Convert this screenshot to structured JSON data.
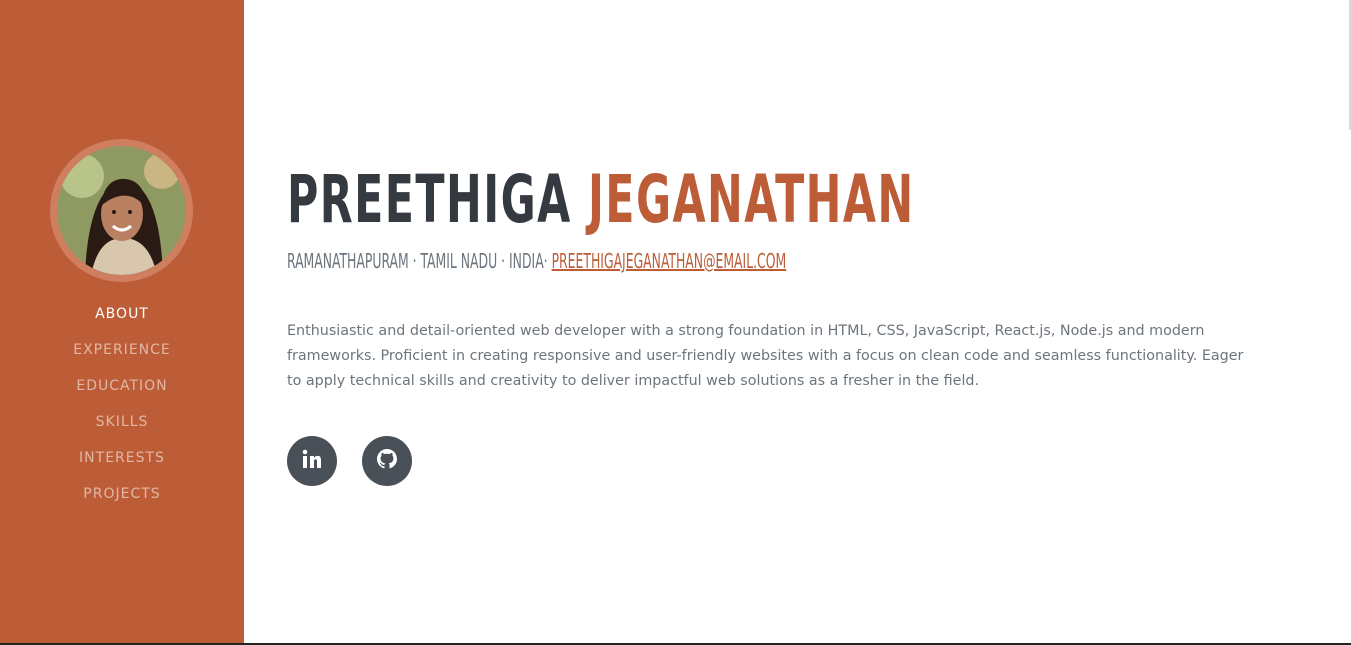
{
  "profile": {
    "avatar_alt": "profile photo",
    "first_name": "PREETHIGA",
    "last_name": "JEGANATHAN",
    "location": "RAMANATHAPURAM · TAMIL NADU · INDIA·",
    "email": "PREETHIGAJEGANATHAN@EMAIL.COM",
    "bio": "Enthusiastic and detail-oriented web developer with a strong foundation in HTML, CSS, JavaScript, React.js, Node.js and modern frameworks. Proficient in creating responsive and user-friendly websites with a focus on clean code and seamless functionality. Eager to apply technical skills and creativity to deliver impactful web solutions as a fresher in the field."
  },
  "nav": {
    "items": [
      {
        "label": "ABOUT",
        "active": true
      },
      {
        "label": "EXPERIENCE",
        "active": false
      },
      {
        "label": "EDUCATION",
        "active": false
      },
      {
        "label": "SKILLS",
        "active": false
      },
      {
        "label": "INTERESTS",
        "active": false
      },
      {
        "label": "PROJECTS",
        "active": false
      }
    ]
  },
  "social": [
    {
      "icon": "linkedin-icon"
    },
    {
      "icon": "github-icon"
    }
  ],
  "colors": {
    "accent": "#bd5d38",
    "heading": "#343a40",
    "muted": "#6c757d",
    "social_bg": "#495057"
  }
}
